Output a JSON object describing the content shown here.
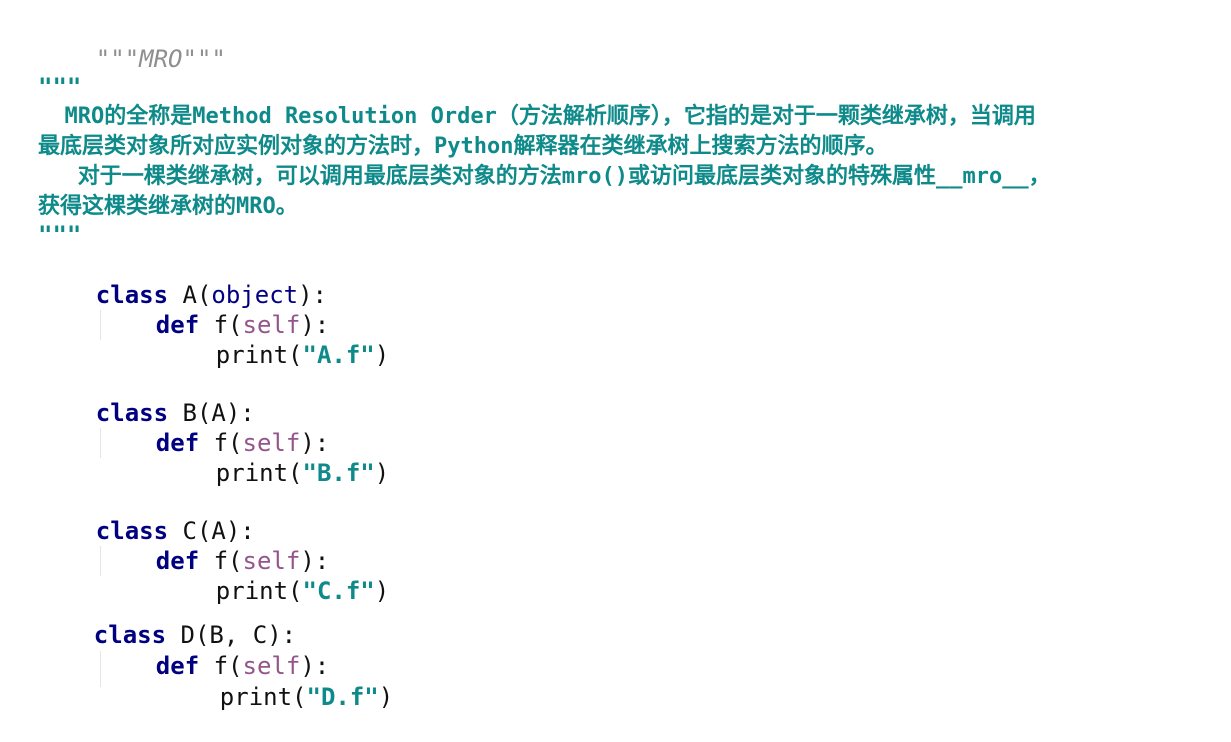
{
  "editor": {
    "top_docstring": {
      "open": "\"\"\"",
      "text": "MRO",
      "close": "\"\"\""
    },
    "doc_block": {
      "open": "\"\"\"",
      "line1": "  MRO的全称是Method Resolution Order（方法解析顺序），它指的是对于一颗类继承树，当调用",
      "line2": "最底层类对象所对应实例对象的方法时，Python解释器在类继承树上搜索方法的顺序。",
      "line3": "   对于一棵类继承树，可以调用最底层类对象的方法mro()或访问最底层类对象的特殊属性__mro__，",
      "line4": "获得这棵类继承树的MRO。",
      "close": "\"\"\""
    },
    "classes": [
      {
        "kw": "class",
        "name": " A(",
        "base": "object",
        "tail": "):",
        "def_kw": "def",
        "def_name": " f(",
        "self": "self",
        "def_tail": "):",
        "print": "print(",
        "str": "\"A.f\"",
        "close": ")"
      },
      {
        "kw": "class",
        "name": " B(A):",
        "def_kw": "def",
        "def_name": " f(",
        "self": "self",
        "def_tail": "):",
        "print": "print(",
        "str": "\"B.f\"",
        "close": ")"
      },
      {
        "kw": "class",
        "name": " C(A):",
        "def_kw": "def",
        "def_name": " f(",
        "self": "self",
        "def_tail": "):",
        "print": "print(",
        "str": "\"C.f\"",
        "close": ")"
      },
      {
        "kw": "class",
        "name": " D(B, C):",
        "def_kw": "def",
        "def_name": " f(",
        "self": "self",
        "def_tail": "):",
        "print": "print(",
        "str": "\"D.f\"",
        "close": ")"
      }
    ]
  }
}
